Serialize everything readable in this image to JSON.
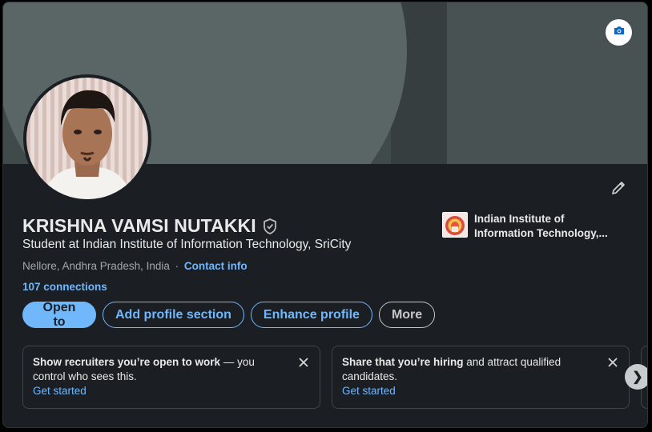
{
  "profile": {
    "name": "KRISHNA VAMSI NUTAKKI",
    "headline": "Student at Indian Institute of Information Technology, SriCity",
    "location": "Nellore, Andhra Pradesh, India",
    "separator": "·",
    "contact_info_label": "Contact info",
    "connections": "107 connections"
  },
  "education": {
    "name_line1": "Indian Institute of",
    "name_line2": "Information Technology,..."
  },
  "actions": {
    "open_to": "Open to",
    "add_section": "Add profile section",
    "enhance": "Enhance profile",
    "more": "More"
  },
  "promos": [
    {
      "bold": "Show recruiters you’re open to work",
      "rest": " — you control who sees this.",
      "cta": "Get started"
    },
    {
      "bold": "Share that you’re hiring",
      "rest": " and attract qualified candidates.",
      "cta": "Get started"
    }
  ],
  "icons": {
    "camera": "camera-icon",
    "edit": "pencil-icon",
    "verify": "shield-check-icon",
    "close": "close-icon",
    "next": "chevron-right-icon"
  },
  "next_glyph": "❯",
  "colors": {
    "background": "#1b1f23",
    "accent": "#71b7fb",
    "banner": "#404a4a"
  }
}
